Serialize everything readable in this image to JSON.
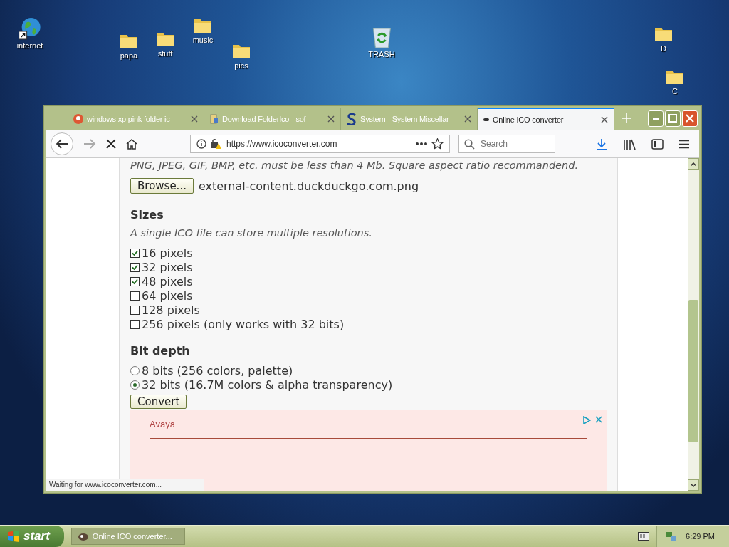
{
  "desktop": {
    "icons": [
      {
        "label": "internet",
        "kind": "globe"
      },
      {
        "label": "papa",
        "kind": "folder"
      },
      {
        "label": "stuff",
        "kind": "folder"
      },
      {
        "label": "music",
        "kind": "folder"
      },
      {
        "label": "pics",
        "kind": "folder"
      },
      {
        "label": "TRASH",
        "kind": "trash"
      },
      {
        "label": "D",
        "kind": "folder"
      },
      {
        "label": "C",
        "kind": "folder"
      }
    ]
  },
  "browser": {
    "tabs": [
      {
        "title": "windows xp pink folder ic",
        "selected": false,
        "kind": "duck"
      },
      {
        "title": "Download FolderIco - sof",
        "selected": false,
        "kind": "doc"
      },
      {
        "title": "System - System Miscellar",
        "selected": false,
        "kind": "s"
      },
      {
        "title": "Online ICO converter",
        "selected": true,
        "kind": "dot"
      }
    ],
    "url": "https://www.icoconverter.com",
    "search": {
      "placeholder": "Search"
    },
    "status": "Waiting for www.icoconverter.com..."
  },
  "page": {
    "intro": "PNG, JPEG, GIF, BMP, etc. must be less than 4 Mb. Square aspect ratio recommandend.",
    "browse_button": "Browse...",
    "file_name": "external-content.duckduckgo.com.png",
    "sizes": {
      "heading": "Sizes",
      "note": "A single ICO file can store multiple resolutions.",
      "options": [
        {
          "label": "16 pixels",
          "checked": true
        },
        {
          "label": "32 pixels",
          "checked": true
        },
        {
          "label": "48 pixels",
          "checked": true
        },
        {
          "label": "64 pixels",
          "checked": false
        },
        {
          "label": "128 pixels",
          "checked": false
        },
        {
          "label": "256 pixels (only works with 32 bits)",
          "checked": false
        }
      ]
    },
    "bit_depth": {
      "heading": "Bit depth",
      "options": [
        {
          "label": "8 bits (256 colors, palette)",
          "selected": false
        },
        {
          "label": "32 bits (16.7M colors & alpha transparency)",
          "selected": true
        }
      ]
    },
    "convert_button": "Convert",
    "ad": {
      "advertiser": "Avaya"
    }
  },
  "taskbar": {
    "start": "start",
    "task": "Online ICO converter...",
    "clock": "6:29 PM"
  }
}
